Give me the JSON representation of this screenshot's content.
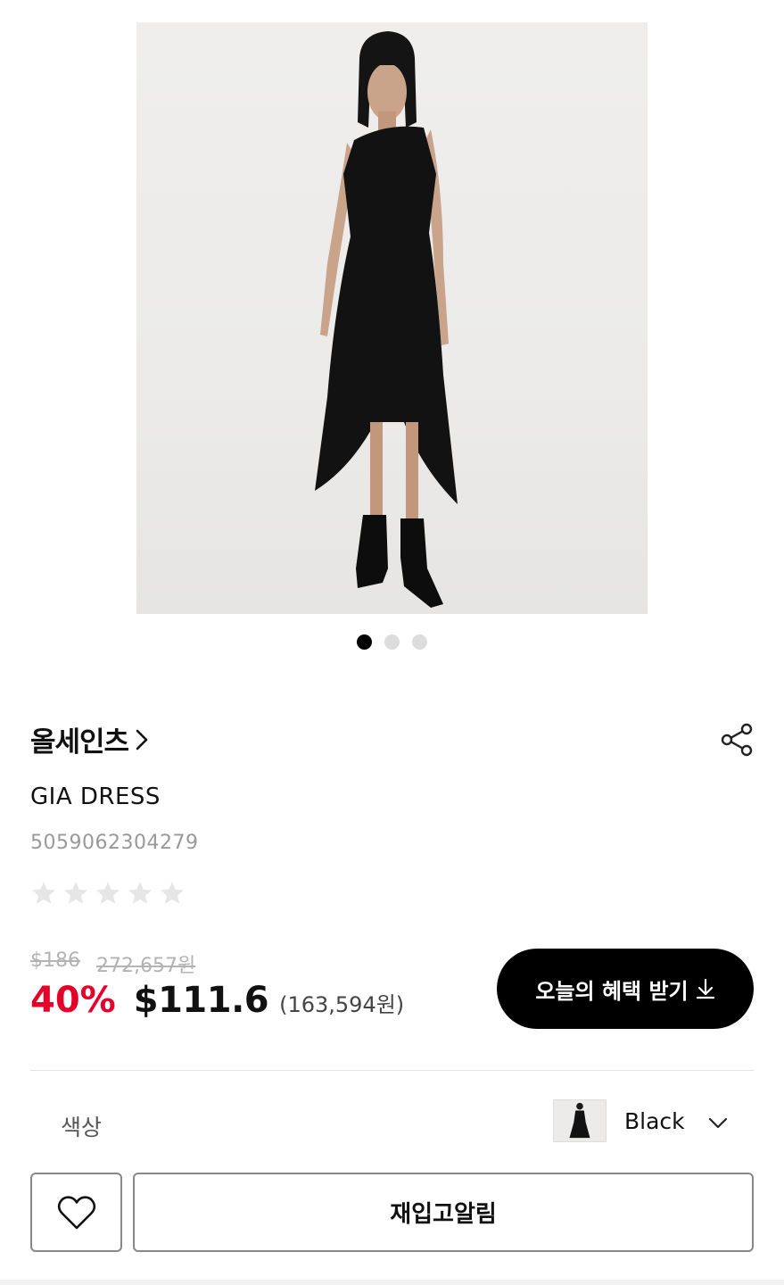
{
  "product": {
    "brand": "올세인츠",
    "name": "GIA DRESS",
    "code": "5059062304279",
    "rating_stars": 0,
    "rating_max": 5
  },
  "gallery": {
    "image_count": 3,
    "active_index": 0
  },
  "price": {
    "original_usd": "$186",
    "original_krw": "272,657원",
    "discount": "40%",
    "sale_usd": "$111.6",
    "sale_krw": "(163,594원)"
  },
  "benefit_button": {
    "label": "오늘의 혜택 받기"
  },
  "option": {
    "label": "색상",
    "selected": "Black"
  },
  "actions": {
    "restock_label": "재입고알림"
  },
  "colors": {
    "discount": "#e4002b",
    "primary_button": "#000000",
    "star_empty": "#e6e6e6"
  },
  "icons": [
    "chevron-right-icon",
    "share-icon",
    "star-icon",
    "download-arrow-icon",
    "chevron-down-icon",
    "heart-icon"
  ]
}
